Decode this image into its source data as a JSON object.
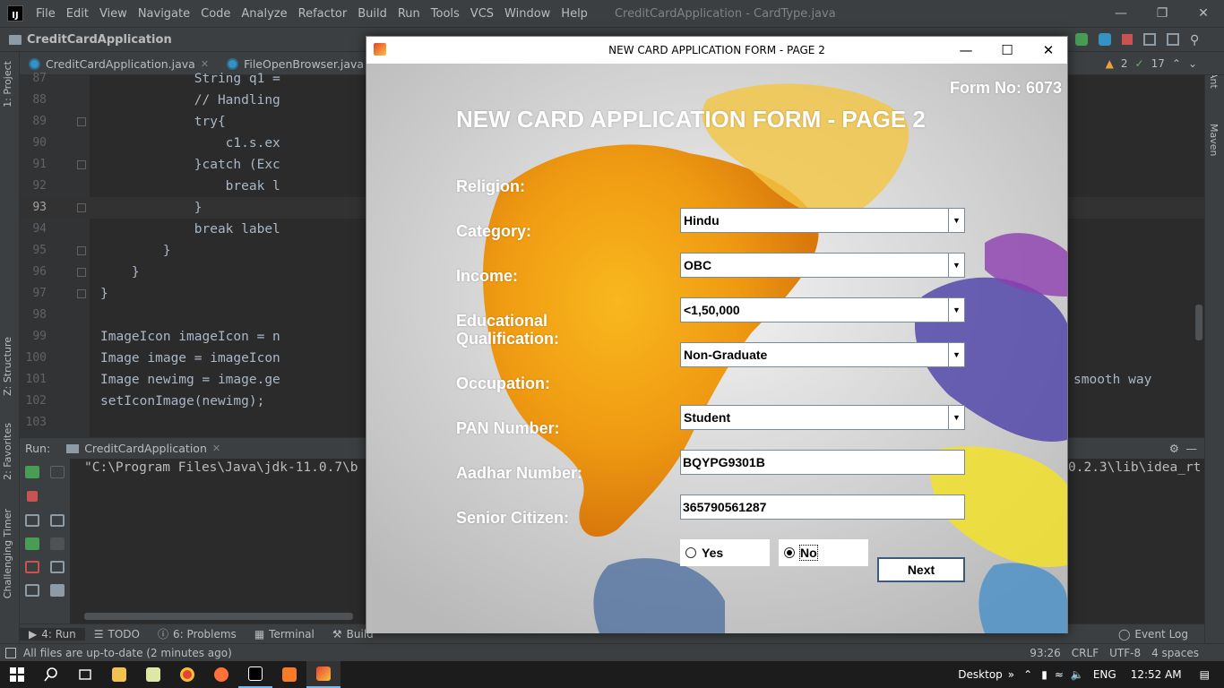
{
  "menu": {
    "items": [
      "File",
      "Edit",
      "View",
      "Navigate",
      "Code",
      "Analyze",
      "Refactor",
      "Build",
      "Run",
      "Tools",
      "VCS",
      "Window",
      "Help"
    ],
    "window_title": "CreditCardApplication - CardType.java"
  },
  "nav": {
    "project": "CreditCardApplication"
  },
  "tabs": [
    {
      "label": "CreditCardApplication.java"
    },
    {
      "label": "FileOpenBrowser.java"
    },
    {
      "label": "C"
    }
  ],
  "inspections": {
    "warnings": "2",
    "weak": "17"
  },
  "side_tools": {
    "project": "1: Project",
    "structure": "Z: Structure",
    "favorites": "2: Favorites",
    "timer": "Challenging Timer",
    "ant": "Ant",
    "maven": "Maven"
  },
  "editor": {
    "lines": [
      {
        "num": "87",
        "code": "            String q1 ="
      },
      {
        "num": "88",
        "code": "            // Handling"
      },
      {
        "num": "89",
        "code": "            try{"
      },
      {
        "num": "90",
        "code": "                c1.s.ex"
      },
      {
        "num": "91",
        "code": "            }catch (Exc"
      },
      {
        "num": "92",
        "code": "                break l"
      },
      {
        "num": "93",
        "code": "            }"
      },
      {
        "num": "94",
        "code": "            break label"
      },
      {
        "num": "95",
        "code": "        }"
      },
      {
        "num": "96",
        "code": "    }"
      },
      {
        "num": "97",
        "code": "}"
      },
      {
        "num": "98",
        "code": ""
      },
      {
        "num": "99",
        "code": "ImageIcon imageIcon = n"
      },
      {
        "num": "100",
        "code": "Image image = imageIcon"
      },
      {
        "num": "101",
        "code": "Image newimg = image.ge"
      },
      {
        "num": "102",
        "code": "setIconImage(newimg);"
      },
      {
        "num": "103",
        "code": ""
      }
    ],
    "overflow_text": "smooth way"
  },
  "run_panel": {
    "label": "Run:",
    "config": "CreditCardApplication",
    "console_left": "\"C:\\Program Files\\Java\\jdk-11.0.7\\b",
    "console_right": "0.2.3\\lib\\idea_rt"
  },
  "tool_windows": [
    {
      "label": "4: Run"
    },
    {
      "label": "TODO"
    },
    {
      "label": "6: Problems"
    },
    {
      "label": "Terminal"
    },
    {
      "label": "Build"
    }
  ],
  "event_log": "Event Log",
  "status": {
    "message": "All files are up-to-date (2 minutes ago)",
    "position": "93:26",
    "line_sep": "CRLF",
    "encoding": "UTF-8",
    "indent": "4 spaces"
  },
  "taskbar": {
    "desktop": "Desktop",
    "lang": "ENG",
    "time": "12:52 AM"
  },
  "dialog": {
    "title": "NEW CARD APPLICATION FORM - PAGE 2",
    "form_no": "Form No: 6073",
    "heading": "NEW CARD APPLICATION FORM - PAGE 2",
    "fields": {
      "religion": {
        "label": "Religion:",
        "value": "Hindu"
      },
      "category": {
        "label": "Category:",
        "value": "OBC"
      },
      "income": {
        "label": "Income:",
        "value": "<1,50,000"
      },
      "education": {
        "label_1": "Educational",
        "label_2": "Qualification:",
        "value": "Non-Graduate"
      },
      "occupation": {
        "label": "Occupation:",
        "value": "Student"
      },
      "pan": {
        "label": "PAN Number:",
        "value": "BQYPG9301B"
      },
      "aadhar": {
        "label": "Aadhar Number:",
        "value": "365790561287"
      },
      "senior": {
        "label": "Senior Citizen:",
        "yes": "Yes",
        "no": "No",
        "selected": "No"
      }
    },
    "next_label": "Next"
  },
  "colors": {
    "ide_bg": "#2b2b2b",
    "ide_panel": "#3c3f41",
    "keyword": "#cc7832",
    "accent": "#4a88c7"
  }
}
